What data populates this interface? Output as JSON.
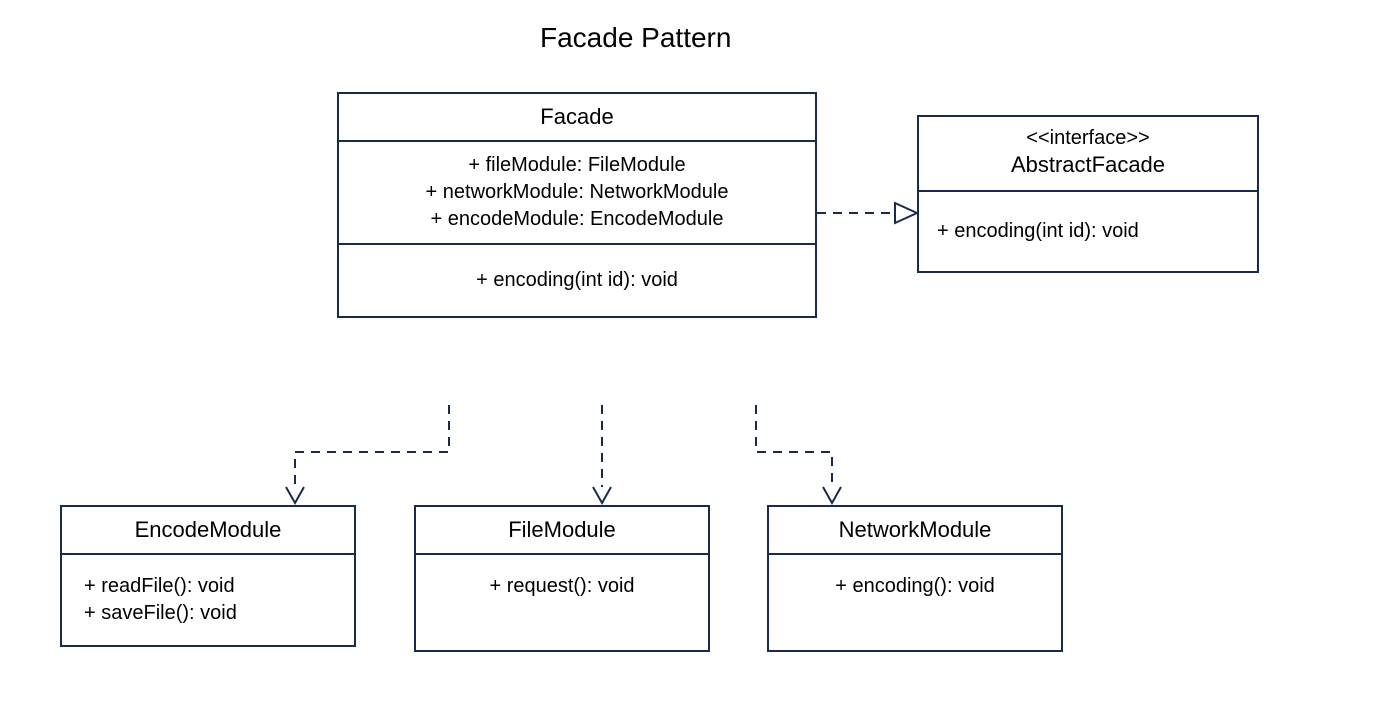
{
  "diagram": {
    "title": "Facade Pattern",
    "classes": {
      "facade": {
        "name": "Facade",
        "attributes": [
          "+  fileModule: FileModule",
          "+  networkModule: NetworkModule",
          "+  encodeModule: EncodeModule"
        ],
        "operations": [
          "+   encoding(int id): void"
        ]
      },
      "abstractFacade": {
        "stereotype": "<<interface>>",
        "name": "AbstractFacade",
        "operations": [
          "+   encoding(int id): void"
        ]
      },
      "encodeModule": {
        "name": "EncodeModule",
        "operations": [
          "+   readFile(): void",
          "+   saveFile(): void"
        ]
      },
      "fileModule": {
        "name": "FileModule",
        "operations": [
          "+   request(): void"
        ]
      },
      "networkModule": {
        "name": "NetworkModule",
        "operations": [
          "+   encoding(): void"
        ]
      }
    },
    "relations": [
      {
        "from": "Facade",
        "to": "AbstractFacade",
        "type": "realization"
      },
      {
        "from": "Facade",
        "to": "EncodeModule",
        "type": "dependency"
      },
      {
        "from": "Facade",
        "to": "FileModule",
        "type": "dependency"
      },
      {
        "from": "Facade",
        "to": "NetworkModule",
        "type": "dependency"
      }
    ]
  }
}
